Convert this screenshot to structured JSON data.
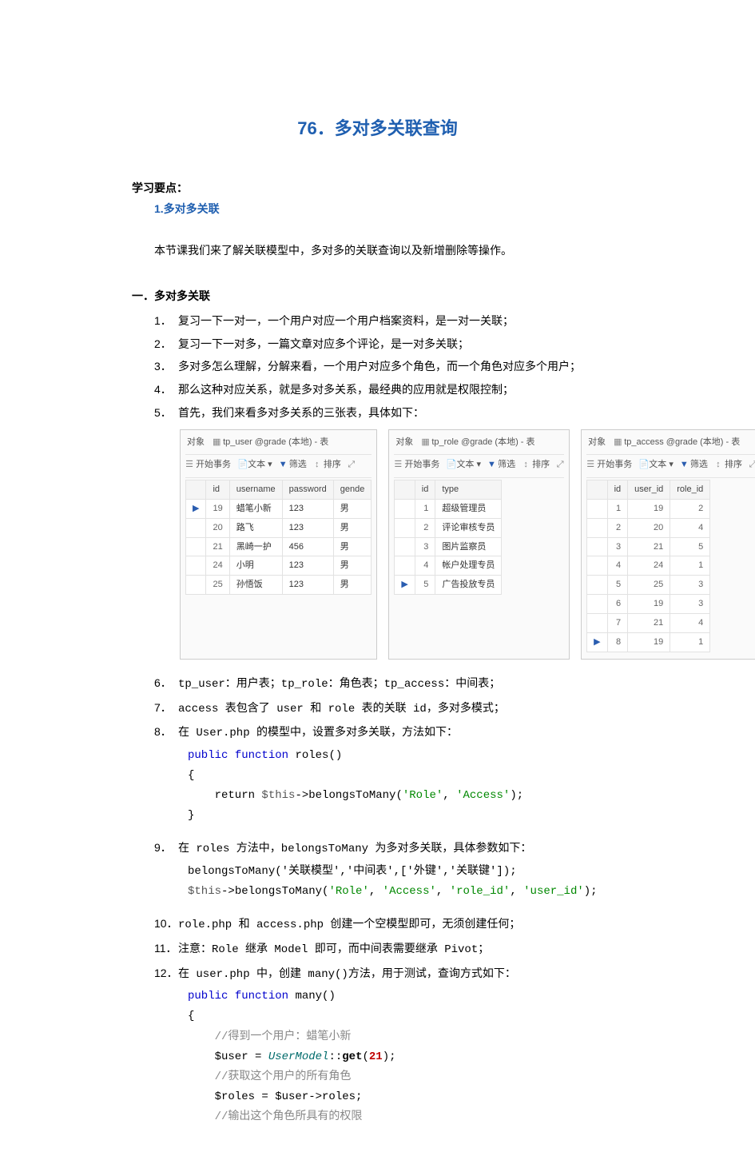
{
  "title": {
    "num": "76．",
    "text": "多对多关联查询"
  },
  "keypoints": {
    "label": "学习要点：",
    "item": "1.多对多关联"
  },
  "intro": "本节课我们来了解关联模型中，多对多的关联查询以及新增删除等操作。",
  "section": "一．多对多关联",
  "items": {
    "i1": {
      "n": "1．",
      "t": "复习一下一对一，一个用户对应一个用户档案资料，是一对一关联；"
    },
    "i2": {
      "n": "2．",
      "t": "复习一下一对多，一篇文章对应多个评论，是一对多关联；"
    },
    "i3": {
      "n": "3．",
      "t": "多对多怎么理解，分解来看，一个用户对应多个角色，而一个角色对应多个用户；"
    },
    "i4": {
      "n": "4．",
      "t": "那么这种对应关系，就是多对多关系，最经典的应用就是权限控制；"
    },
    "i5": {
      "n": "5．",
      "t": "首先，我们来看多对多关系的三张表，具体如下："
    },
    "i6": {
      "n": "6．",
      "t": "tp_user：用户表；tp_role：角色表；tp_access：中间表；"
    },
    "i7": {
      "n": "7．",
      "t": "access 表包含了 user 和 role 表的关联 id，多对多模式；"
    },
    "i8": {
      "n": "8．",
      "t": "在 User.php 的模型中，设置多对多关联，方法如下："
    },
    "i9": {
      "n": "9．",
      "t": "在 roles 方法中，belongsToMany 为多对多关联，具体参数如下："
    },
    "i10": {
      "n": "10．",
      "t": "role.php 和 access.php 创建一个空模型即可，无须创建任何；"
    },
    "i11": {
      "n": "11．",
      "t": "注意：Role 继承 Model 即可，而中间表需要继承 Pivot；"
    },
    "i12": {
      "n": "12．",
      "t": "在 user.php 中，创建 many()方法，用于测试，查询方式如下："
    }
  },
  "code8": {
    "l1a": "public",
    "l1b": " function",
    "l1c": " roles()",
    "l2": "{",
    "l3a": "    return ",
    "l3b": "$this",
    "l3c": "->belongsToMany(",
    "l3d": "'Role'",
    "l3e": ", ",
    "l3f": "'Access'",
    "l3g": ");",
    "l4": "}"
  },
  "code9": {
    "l1": "belongsToMany('关联模型','中间表',['外键','关联键']);",
    "l2a": "$this",
    "l2b": "->belongsToMany(",
    "l2c": "'Role'",
    "l2d": ", ",
    "l2e": "'Access'",
    "l2f": ", ",
    "l2g": "'role_id'",
    "l2h": ", ",
    "l2i": "'user_id'",
    "l2j": ");"
  },
  "code12": {
    "l1a": "public",
    "l1b": " function",
    "l1c": " many()",
    "l2": "{",
    "l3": "    //得到一个用户：蜡笔小新",
    "l4a": "    $user = ",
    "l4b": "UserModel",
    "l4c": "::",
    "l4d": "get",
    "l4e": "(",
    "l4f": "21",
    "l4g": ");",
    "l5": "    //获取这个用户的所有角色",
    "l6a": "    $roles = $user->roles;",
    "l7": "    //输出这个角色所具有的权限"
  },
  "db": {
    "obj": "对象",
    "start": "开始事务",
    "txt": "文本",
    "filter": "筛选",
    "sort": "排序",
    "user": {
      "tab": "tp_user @grade (本地) - 表",
      "cols": {
        "id": "id",
        "username": "username",
        "password": "password",
        "gender": "gende"
      },
      "rows": [
        {
          "id": "19",
          "u": "蜡笔小新",
          "p": "123",
          "g": "男"
        },
        {
          "id": "20",
          "u": "路飞",
          "p": "123",
          "g": "男"
        },
        {
          "id": "21",
          "u": "黑崎一护",
          "p": "456",
          "g": "男"
        },
        {
          "id": "24",
          "u": "小明",
          "p": "123",
          "g": "男"
        },
        {
          "id": "25",
          "u": "孙悟饭",
          "p": "123",
          "g": "男"
        }
      ]
    },
    "role": {
      "tab": "tp_role @grade (本地) - 表",
      "cols": {
        "id": "id",
        "type": "type"
      },
      "rows": [
        {
          "id": "1",
          "t": "超级管理员"
        },
        {
          "id": "2",
          "t": "评论审核专员"
        },
        {
          "id": "3",
          "t": "图片监察员"
        },
        {
          "id": "4",
          "t": "帐户处理专员"
        },
        {
          "id": "5",
          "t": "广告投放专员"
        }
      ]
    },
    "access": {
      "tab": "tp_access @grade (本地) - 表",
      "cols": {
        "id": "id",
        "uid": "user_id",
        "rid": "role_id"
      },
      "rows": [
        {
          "id": "1",
          "u": "19",
          "r": "2"
        },
        {
          "id": "2",
          "u": "20",
          "r": "4"
        },
        {
          "id": "3",
          "u": "21",
          "r": "5"
        },
        {
          "id": "4",
          "u": "24",
          "r": "1"
        },
        {
          "id": "5",
          "u": "25",
          "r": "3"
        },
        {
          "id": "6",
          "u": "19",
          "r": "3"
        },
        {
          "id": "7",
          "u": "21",
          "r": "4"
        },
        {
          "id": "8",
          "u": "19",
          "r": "1"
        }
      ]
    }
  }
}
